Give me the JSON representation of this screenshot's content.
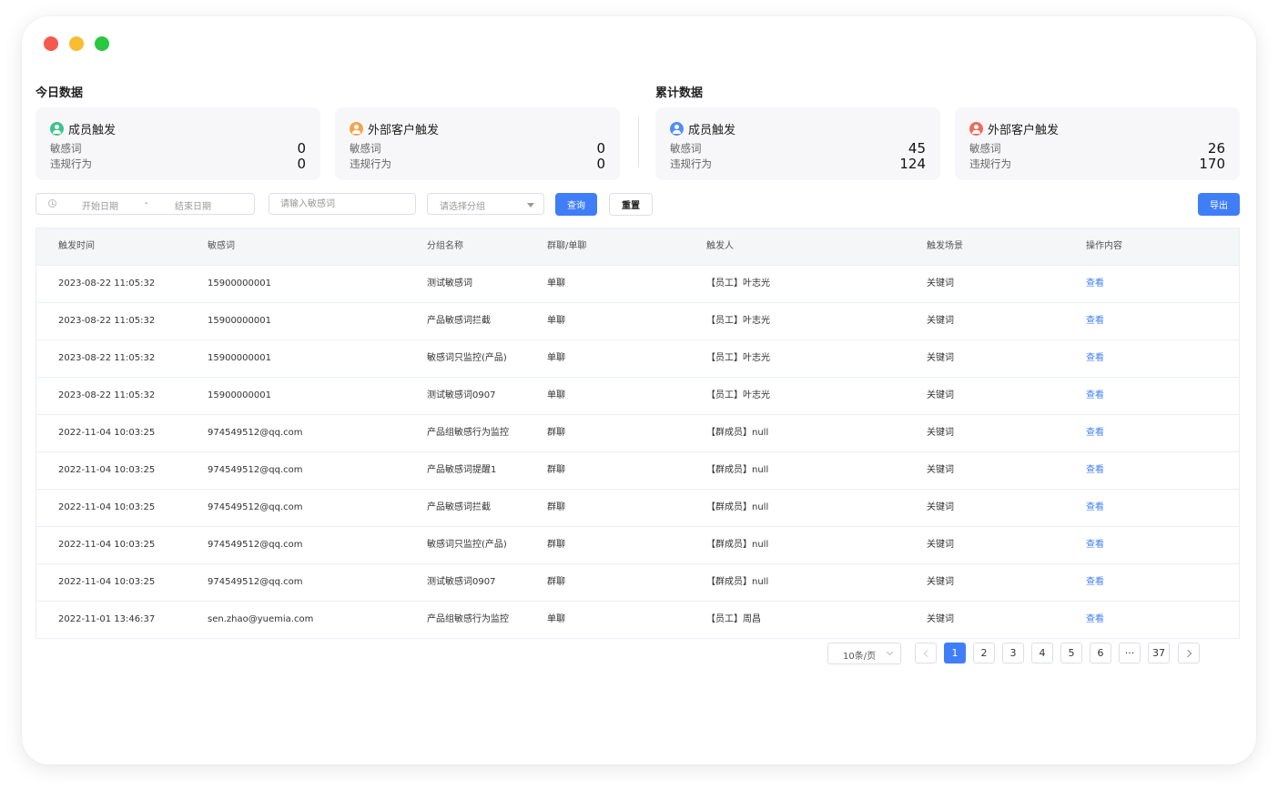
{
  "today": {
    "title": "今日数据",
    "cards": [
      {
        "name": "成员触发",
        "icon_color": "#3cc48a",
        "rows": [
          {
            "label": "敏感词",
            "value": "0"
          },
          {
            "label": "违规行为",
            "value": "0"
          }
        ]
      },
      {
        "name": "外部客户触发",
        "icon_color": "#f5a34a",
        "rows": [
          {
            "label": "敏感词",
            "value": "0"
          },
          {
            "label": "违规行为",
            "value": "0"
          }
        ]
      }
    ]
  },
  "cumulative": {
    "title": "累计数据",
    "cards": [
      {
        "name": "成员触发",
        "icon_color": "#4f8ef6",
        "rows": [
          {
            "label": "敏感词",
            "value": "45"
          },
          {
            "label": "违规行为",
            "value": "124"
          }
        ]
      },
      {
        "name": "外部客户触发",
        "icon_color": "#f06a5a",
        "rows": [
          {
            "label": "敏感词",
            "value": "26"
          },
          {
            "label": "违规行为",
            "value": "170"
          }
        ]
      }
    ]
  },
  "filters": {
    "date_start_placeholder": "开始日期",
    "date_separator": "-",
    "date_end_placeholder": "结束日期",
    "keyword_placeholder": "请输入敏感词",
    "group_placeholder": "请选择分组",
    "query_label": "查询",
    "reset_label": "重置",
    "export_label": "导出"
  },
  "table": {
    "headers": [
      "触发时间",
      "敏感词",
      "分组名称",
      "群聊/单聊",
      "触发人",
      "触发场景",
      "操作内容"
    ],
    "rows": [
      [
        "2023-08-22 11:05:32",
        "15900000001",
        "测试敏感词",
        "单聊",
        "【员工】叶志光",
        "关键词",
        "查看"
      ],
      [
        "2023-08-22 11:05:32",
        "15900000001",
        "产品敏感词拦截",
        "单聊",
        "【员工】叶志光",
        "关键词",
        "查看"
      ],
      [
        "2023-08-22 11:05:32",
        "15900000001",
        "敏感词只监控(产品)",
        "单聊",
        "【员工】叶志光",
        "关键词",
        "查看"
      ],
      [
        "2023-08-22 11:05:32",
        "15900000001",
        "测试敏感词0907",
        "单聊",
        "【员工】叶志光",
        "关键词",
        "查看"
      ],
      [
        "2022-11-04 10:03:25",
        "974549512@qq.com",
        "产品组敏感行为监控",
        "群聊",
        "【群成员】null",
        "关键词",
        "查看"
      ],
      [
        "2022-11-04 10:03:25",
        "974549512@qq.com",
        "产品敏感词提醒1",
        "群聊",
        "【群成员】null",
        "关键词",
        "查看"
      ],
      [
        "2022-11-04 10:03:25",
        "974549512@qq.com",
        "产品敏感词拦截",
        "群聊",
        "【群成员】null",
        "关键词",
        "查看"
      ],
      [
        "2022-11-04 10:03:25",
        "974549512@qq.com",
        "敏感词只监控(产品)",
        "群聊",
        "【群成员】null",
        "关键词",
        "查看"
      ],
      [
        "2022-11-04 10:03:25",
        "974549512@qq.com",
        "测试敏感词0907",
        "群聊",
        "【群成员】null",
        "关键词",
        "查看"
      ],
      [
        "2022-11-01 13:46:37",
        "sen.zhao@yuemia.com",
        "产品组敏感行为监控",
        "单聊",
        "【员工】周昌",
        "关键词",
        "查看"
      ]
    ]
  },
  "pagination": {
    "page_size_label": "10条/页",
    "pages": [
      "1",
      "2",
      "3",
      "4",
      "5",
      "6",
      "···",
      "37"
    ],
    "current_page": "1"
  },
  "colors": {
    "accent": "#3f7ef7",
    "card_bg": "#f7f7f9"
  }
}
